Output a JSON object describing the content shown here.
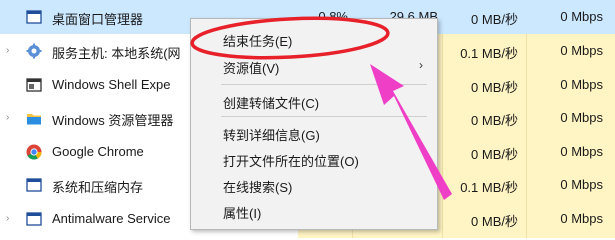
{
  "processes": [
    {
      "name": "桌面窗口管理器",
      "icon": "desktop-window-icon",
      "expandable": false,
      "cpu": "0.8%",
      "memory": "29.6 MB",
      "disk": "0 MB/秒",
      "network": "0 Mbps"
    },
    {
      "name": "服务主机: 本地系统(网",
      "icon": "gear-icon",
      "expandable": true,
      "cpu": "",
      "memory": "",
      "disk": "0.1 MB/秒",
      "network": "0 Mbps"
    },
    {
      "name": "Windows Shell Expe",
      "icon": "window-icon",
      "expandable": false,
      "cpu": "",
      "memory": "",
      "disk": "0 MB/秒",
      "network": "0 Mbps"
    },
    {
      "name": "Windows 资源管理器",
      "icon": "folder-icon",
      "expandable": true,
      "cpu": "",
      "memory": "",
      "disk": "0 MB/秒",
      "network": "0 Mbps"
    },
    {
      "name": "Google Chrome",
      "icon": "chrome-icon",
      "expandable": false,
      "cpu": "",
      "memory": "",
      "disk": "0 MB/秒",
      "network": "0 Mbps"
    },
    {
      "name": "系统和压缩内存",
      "icon": "system-icon",
      "expandable": false,
      "cpu": "",
      "memory": "",
      "disk": "0.1 MB/秒",
      "network": "0 Mbps"
    },
    {
      "name": "Antimalware Service",
      "icon": "shield-icon",
      "expandable": true,
      "cpu": "",
      "memory": "",
      "disk": "0 MB/秒",
      "network": "0 Mbps"
    }
  ],
  "context_menu": {
    "items": [
      {
        "label": "结束任务(E)"
      },
      {
        "label": "资源值(V)",
        "has_submenu": true
      },
      {
        "label": "创建转储文件(C)"
      },
      {
        "label": "转到详细信息(G)"
      },
      {
        "label": "打开文件所在的位置(O)"
      },
      {
        "label": "在线搜索(S)"
      },
      {
        "label": "属性(I)"
      }
    ]
  },
  "colors": {
    "selected_row": "#cce8ff",
    "usage_shade": "#fff4c4",
    "annotation_red": "#e8202a",
    "annotation_arrow": "#ee3fc6"
  }
}
